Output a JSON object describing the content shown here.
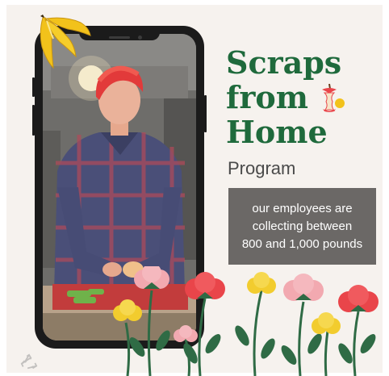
{
  "promo": {
    "title_lines": [
      "Scraps",
      "from",
      "Home"
    ],
    "subtitle": "Program",
    "callout": "our employees are collecting between 800 and 1,000 pounds"
  },
  "icons": [
    "banana-peel-icon",
    "apple-core-icon",
    "recycle-icon"
  ],
  "colors": {
    "title_green": "#1f6a3c",
    "callout_bg": "#6b6866",
    "card_bg": "#f6f2ee",
    "banana_yellow": "#f2c21b",
    "flower_red": "#e9454a",
    "flower_pink": "#f2a9b0",
    "flower_yellow": "#f2cc2e",
    "stem_green": "#2f6b45"
  }
}
